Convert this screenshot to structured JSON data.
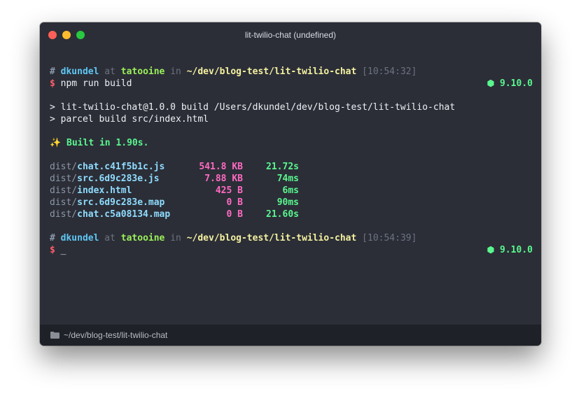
{
  "window": {
    "title": "lit-twilio-chat (undefined)"
  },
  "prompt1": {
    "hash": "#",
    "user": "dkundel",
    "at": "at",
    "host": "tatooine",
    "in": "in",
    "path": "~/dev/blog-test/lit-twilio-chat",
    "time": "[10:54:32]",
    "dollar": "$",
    "command": "npm run build",
    "node_icon": "hexagon-icon",
    "node_version": "9.10.0"
  },
  "output": {
    "line1": "> lit-twilio-chat@1.0.0 build /Users/dkundel/dev/blog-test/lit-twilio-chat",
    "line2": "> parcel build src/index.html",
    "sparkle": "✨",
    "built": "Built in 1.90s."
  },
  "files": [
    {
      "dir": "dist/",
      "name": "chat.c41f5b1c.js",
      "size": "541.8 KB",
      "time": "21.72s"
    },
    {
      "dir": "dist/",
      "name": "src.6d9c283e.js",
      "size": "7.88 KB",
      "time": "74ms"
    },
    {
      "dir": "dist/",
      "name": "index.html",
      "size": "425 B",
      "time": "6ms"
    },
    {
      "dir": "dist/",
      "name": "src.6d9c283e.map",
      "size": "0 B",
      "time": "90ms"
    },
    {
      "dir": "dist/",
      "name": "chat.c5a08134.map",
      "size": "0 B",
      "time": "21.60s"
    }
  ],
  "prompt2": {
    "hash": "#",
    "user": "dkundel",
    "at": "at",
    "host": "tatooine",
    "in": "in",
    "path": "~/dev/blog-test/lit-twilio-chat",
    "time": "[10:54:39]",
    "dollar": "$",
    "cursor": "_",
    "node_icon": "hexagon-icon",
    "node_version": "9.10.0"
  },
  "statusbar": {
    "icon": "folder-icon",
    "path": "~/dev/blog-test/lit-twilio-chat"
  },
  "colors": {
    "background": "#2b2e37",
    "user": "#5fc6f3",
    "host": "#9bf05a",
    "path": "#f4f0a0",
    "dollar": "#ff5d6b",
    "green": "#5af78e",
    "size": "#ff6ac1",
    "file": "#8fdcff"
  }
}
